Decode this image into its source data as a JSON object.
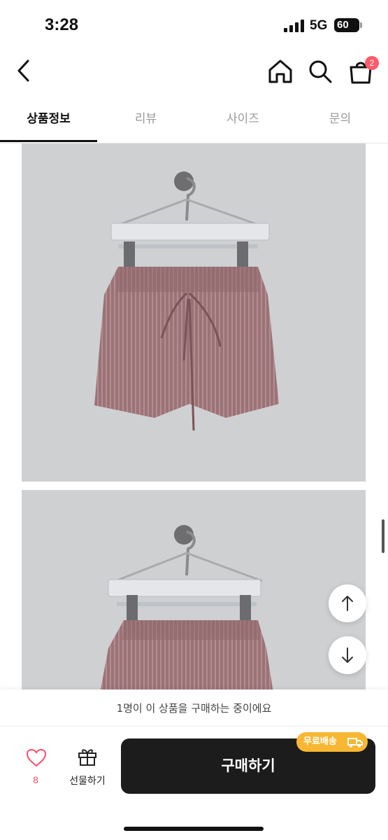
{
  "status": {
    "time": "3:28",
    "network": "5G",
    "battery": "60"
  },
  "nav": {
    "cart_count": "2",
    "icons": [
      "back-icon",
      "home-icon",
      "search-icon",
      "shopping-bag-icon"
    ]
  },
  "tabs": [
    {
      "label": "상품정보",
      "active": true
    },
    {
      "label": "리뷰",
      "active": false
    },
    {
      "label": "사이즈",
      "active": false
    },
    {
      "label": "문의",
      "active": false
    }
  ],
  "bottom": {
    "notice": "1명이 이 상품을 구매하는 중이에요",
    "like_count": "8",
    "gift_label": "선물하기",
    "buy_label": "구매하기",
    "shipping_badge": "무료배송"
  },
  "colors": {
    "accent_badge": "#f7b733",
    "like": "#ff4d6d",
    "cart_badge": "#ff5a6b",
    "buy_button": "#1c1c1c"
  }
}
